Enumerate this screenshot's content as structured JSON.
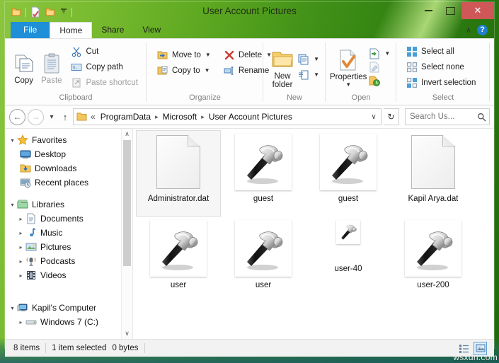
{
  "window": {
    "title": "User Account Pictures",
    "quick_access": [
      {
        "name": "folder-icon",
        "label": "Folder"
      },
      {
        "name": "properties-icon",
        "label": "Properties"
      },
      {
        "name": "new-folder-icon",
        "label": "New folder"
      },
      {
        "name": "chevron-down-icon",
        "label": "Customize Quick Access Toolbar"
      }
    ],
    "controls": {
      "minimize": "Minimize",
      "maximize": "Maximize",
      "close": "Close"
    }
  },
  "tabs": [
    {
      "label": "File",
      "kind": "file"
    },
    {
      "label": "Home",
      "kind": "active"
    },
    {
      "label": "Share",
      "kind": "idle"
    },
    {
      "label": "View",
      "kind": "idle"
    }
  ],
  "tab_right": {
    "collapse": "∧",
    "help": "?"
  },
  "ribbon": {
    "groups": [
      {
        "name": "Clipboard",
        "label": "Clipboard",
        "big": [
          {
            "label": "Copy",
            "icon": "copy-icon",
            "dim": false
          },
          {
            "label": "Paste",
            "icon": "paste-icon",
            "dim": true
          }
        ],
        "small": [
          {
            "label": "Cut",
            "icon": "cut-icon",
            "dim": false,
            "caret": false
          },
          {
            "label": "Copy path",
            "icon": "copy-path-icon",
            "dim": false,
            "caret": false
          },
          {
            "label": "Paste shortcut",
            "icon": "paste-shortcut-icon",
            "dim": true,
            "caret": false
          }
        ]
      },
      {
        "name": "Organize",
        "label": "Organize",
        "small_cols": [
          [
            {
              "label": "Move to",
              "icon": "move-to-icon",
              "caret": true
            },
            {
              "label": "Copy to",
              "icon": "copy-to-icon",
              "caret": true
            }
          ],
          [
            {
              "label": "Delete",
              "icon": "delete-icon",
              "caret": true
            },
            {
              "label": "Rename",
              "icon": "rename-icon",
              "caret": false
            }
          ]
        ]
      },
      {
        "name": "New",
        "label": "New",
        "big": [
          {
            "label": "New\nfolder",
            "icon": "new-folder-icon",
            "dim": false
          }
        ],
        "small": [
          {
            "label": "",
            "icon": "new-item-icon",
            "caret": true
          },
          {
            "label": "",
            "icon": "easy-access-icon",
            "caret": true
          }
        ]
      },
      {
        "name": "Open",
        "label": "Open",
        "big": [
          {
            "label": "Properties",
            "icon": "properties-icon",
            "dim": false,
            "caret": true
          }
        ],
        "small": [
          {
            "label": "",
            "icon": "open-icon",
            "caret": true
          },
          {
            "label": "",
            "icon": "edit-icon",
            "caret": false
          },
          {
            "label": "",
            "icon": "history-icon",
            "caret": false
          }
        ]
      },
      {
        "name": "Select",
        "label": "Select",
        "small": [
          {
            "label": "Select all",
            "icon": "select-all-icon"
          },
          {
            "label": "Select none",
            "icon": "select-none-icon"
          },
          {
            "label": "Invert selection",
            "icon": "invert-selection-icon"
          }
        ]
      }
    ]
  },
  "address": {
    "back": "←",
    "forward": "→",
    "recent": "▾",
    "up": "↑",
    "overflow": "«",
    "crumbs": [
      "ProgramData",
      "Microsoft",
      "User Account Pictures"
    ],
    "dropdown": "∨",
    "refresh": "↻",
    "search_placeholder": "Search Us..."
  },
  "navpane": {
    "sections": [
      {
        "header": {
          "label": "Favorites",
          "icon": "star-icon",
          "expanded": true
        },
        "items": [
          {
            "label": "Desktop",
            "icon": "desktop-icon",
            "expandable": false
          },
          {
            "label": "Downloads",
            "icon": "downloads-icon",
            "expandable": false
          },
          {
            "label": "Recent places",
            "icon": "recent-places-icon",
            "expandable": false
          }
        ]
      },
      {
        "header": {
          "label": "Libraries",
          "icon": "libraries-icon",
          "expanded": true
        },
        "items": [
          {
            "label": "Documents",
            "icon": "documents-icon",
            "expandable": true
          },
          {
            "label": "Music",
            "icon": "music-icon",
            "expandable": true
          },
          {
            "label": "Pictures",
            "icon": "pictures-icon",
            "expandable": true
          },
          {
            "label": "Podcasts",
            "icon": "podcasts-icon",
            "expandable": true
          },
          {
            "label": "Videos",
            "icon": "videos-icon",
            "expandable": true
          }
        ]
      },
      {
        "header": {
          "label": "Kapil's Computer",
          "icon": "computer-icon",
          "expanded": true
        },
        "items": [
          {
            "label": "Windows 7 (C:)",
            "icon": "drive-icon",
            "expandable": true
          }
        ]
      }
    ],
    "scroll_up": "∧",
    "scroll_down": "∨"
  },
  "files": [
    {
      "name": "Administrator.dat",
      "icon": "dat-file-icon",
      "selected": true,
      "size": "large"
    },
    {
      "name": "guest",
      "icon": "hammer-icon",
      "selected": false,
      "size": "large"
    },
    {
      "name": "guest",
      "icon": "hammer-icon",
      "selected": false,
      "size": "large"
    },
    {
      "name": "Kapil Arya.dat",
      "icon": "dat-file-icon",
      "selected": false,
      "size": "large"
    },
    {
      "name": "user",
      "icon": "hammer-icon",
      "selected": false,
      "size": "large"
    },
    {
      "name": "user",
      "icon": "hammer-icon",
      "selected": false,
      "size": "large"
    },
    {
      "name": "user-40",
      "icon": "hammer-icon",
      "selected": false,
      "size": "small"
    },
    {
      "name": "user-200",
      "icon": "hammer-icon",
      "selected": false,
      "size": "large"
    }
  ],
  "status": {
    "item_count": "8 items",
    "selection": "1 item selected",
    "selection_size": "0 bytes",
    "views": [
      {
        "name": "details-view-button",
        "active": false
      },
      {
        "name": "large-icons-view-button",
        "active": true
      }
    ]
  },
  "watermark": "wsxdn.com",
  "colors": {
    "file_tab": "#1f8fd8",
    "close_button": "#cf5757",
    "selection": "#f6f6f6",
    "ribbon_bg": "#fdfdfd",
    "status_bg": "#f2f2f2"
  }
}
